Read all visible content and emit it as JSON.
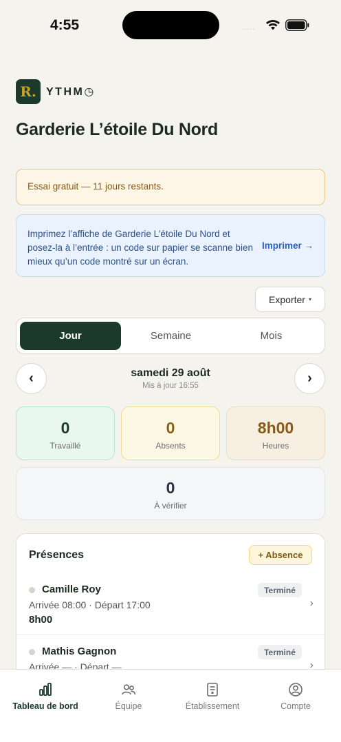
{
  "status_bar": {
    "time": "4:55",
    "signal": "....."
  },
  "brand": {
    "logo_letter": "R.",
    "name": "YTHM◷"
  },
  "page_title": "Garderie L’étoile Du Nord",
  "trial_banner": {
    "text": "Essai gratuit — 11 jours restants."
  },
  "print_banner": {
    "text": "Imprimez l’affiche de Garderie L’étoile Du Nord et posez-la à l’entrée : un code sur papier se scanne bien mieux qu’un code montré sur un écran.",
    "link": "Imprimer →"
  },
  "export": {
    "label": "Exporter",
    "caret": "▾"
  },
  "segmented": {
    "tabs": [
      "Jour",
      "Semaine",
      "Mois"
    ],
    "selected": "Jour"
  },
  "date_nav": {
    "prev": "‹",
    "next": "›",
    "date": "samedi 29 août",
    "updated": "Mis à jour 16:55"
  },
  "stats": [
    {
      "value": "0",
      "label": "Travaillé"
    },
    {
      "value": "0",
      "label": "Absents"
    },
    {
      "value": "8h00",
      "label": "Heures"
    },
    {
      "value": "0",
      "label": "À vérifier"
    }
  ],
  "presences": {
    "title": "Présences",
    "add_absence": "+ Absence",
    "rows": [
      {
        "name": "Camille Roy",
        "times": "Arrivée 08:00  ·  Départ 17:00",
        "hours": "8h00",
        "status": "Terminé"
      },
      {
        "name": "Mathis Gagnon",
        "times": "Arrivée —  ·  Départ —",
        "hours": "",
        "status": "Terminé"
      }
    ]
  },
  "tab_bar": [
    {
      "label": "Tableau de bord",
      "icon": "bar-chart-icon",
      "active": true
    },
    {
      "label": "Équipe",
      "icon": "people-icon",
      "active": false
    },
    {
      "label": "Établissement",
      "icon": "document-icon",
      "active": false
    },
    {
      "label": "Compte",
      "icon": "user-circle-icon",
      "active": false
    }
  ],
  "colors": {
    "brand_dark": "#1b3a2b",
    "gold": "#c9a227",
    "link_blue": "#2c5fb8"
  }
}
